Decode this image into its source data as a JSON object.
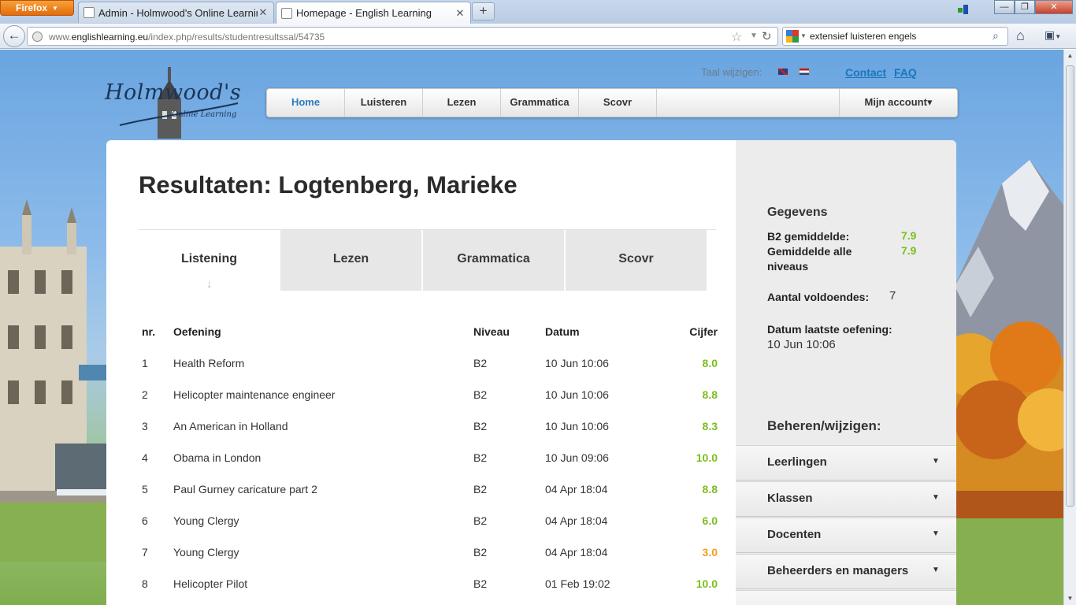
{
  "browser": {
    "menu_button": "Firefox",
    "tabs": [
      {
        "title": "Admin - Holmwood's Online Learning"
      },
      {
        "title": "Homepage - English Learning"
      }
    ],
    "new_tab": "+",
    "url_prefix": "www.",
    "url_domain": "englishlearning.eu",
    "url_path": "/index.php/results/studentresultssal/54735",
    "search_value": "extensief luisteren engels"
  },
  "header": {
    "logo_text": "Holmwood's",
    "logo_subtitle": "Online Learning",
    "language_label": "Taal wijzigen:",
    "links": [
      "Contact",
      "FAQ"
    ]
  },
  "menu": {
    "items": [
      "Home",
      "Luisteren",
      "Lezen",
      "Grammatica",
      "Scovr"
    ],
    "account": "Mijn account▾"
  },
  "main": {
    "title": "Resultaten: Logtenberg, Marieke",
    "tabs": [
      "Listening",
      "Lezen",
      "Grammatica",
      "Scovr"
    ],
    "active_tab_arrow": "↓",
    "columns": {
      "nr": "nr.",
      "exercise": "Oefening",
      "level": "Niveau",
      "date": "Datum",
      "score": "Cijfer"
    },
    "rows": [
      {
        "nr": "1",
        "exercise": "Health Reform",
        "level": "B2",
        "date": "10 Jun 10:06",
        "score": "8.0",
        "color": "#7cbe1f"
      },
      {
        "nr": "2",
        "exercise": "Helicopter maintenance engineer",
        "level": "B2",
        "date": "10 Jun 10:06",
        "score": "8.8",
        "color": "#7cbe1f"
      },
      {
        "nr": "3",
        "exercise": "An American in Holland",
        "level": "B2",
        "date": "10 Jun 10:06",
        "score": "8.3",
        "color": "#7cbe1f"
      },
      {
        "nr": "4",
        "exercise": "Obama in London",
        "level": "B2",
        "date": "10 Jun 09:06",
        "score": "10.0",
        "color": "#7cbe1f"
      },
      {
        "nr": "5",
        "exercise": "Paul Gurney caricature part 2",
        "level": "B2",
        "date": "04 Apr 18:04",
        "score": "8.8",
        "color": "#7cbe1f"
      },
      {
        "nr": "6",
        "exercise": "Young Clergy",
        "level": "B2",
        "date": "04 Apr 18:04",
        "score": "6.0",
        "color": "#7cbe1f"
      },
      {
        "nr": "7",
        "exercise": "Young Clergy",
        "level": "B2",
        "date": "04 Apr 18:04",
        "score": "3.0",
        "color": "#f0a11f"
      },
      {
        "nr": "8",
        "exercise": "Helicopter Pilot",
        "level": "B2",
        "date": "01 Feb 19:02",
        "score": "10.0",
        "color": "#7cbe1f"
      }
    ]
  },
  "sidebar": {
    "heading": "Gegevens",
    "b2_avg_label": "B2 gemiddelde:",
    "b2_avg_value": "7.9",
    "all_avg_label": "Gemiddelde alle niveaus",
    "all_avg_value": "7.9",
    "passes_label": "Aantal voldoendes:",
    "passes_value": "7",
    "last_label": "Datum laatste oefening:",
    "last_value": "10 Jun 10:06",
    "manage_heading": "Beheren/wijzigen:",
    "manage_items": [
      "Leerlingen",
      "Klassen",
      "Docenten",
      "Beheerders en managers"
    ],
    "caret": "▼"
  },
  "colors": {
    "pass": "#7cbe1f",
    "fail": "#f0a11f",
    "link": "#1c75bc",
    "active_menu": "#2a7bbf"
  }
}
